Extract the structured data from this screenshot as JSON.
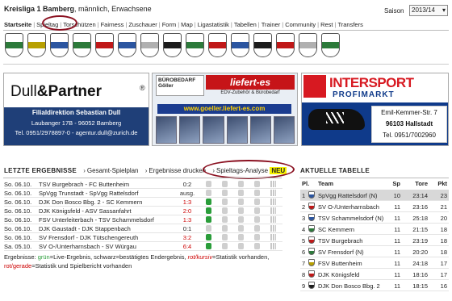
{
  "header": {
    "title_bold": "Kreisliga 1 Bamberg",
    "title_rest": ", männlich, Erwachsene",
    "saison_label": "Saison",
    "saison_value": "2013/14"
  },
  "nav": [
    "Startseite",
    "Spieltag",
    "Torschützen",
    "Fairness",
    "Zuschauer",
    "Form",
    "Map",
    "Ligastatistik",
    "Tabellen",
    "Trainer",
    "Community",
    "Rest",
    "Transfers"
  ],
  "crest_colors": [
    "#2c7a3a",
    "#b8a000",
    "#2b55a0",
    "#2c7a3a",
    "#c01818",
    "#2b55a0",
    "#b0b0b0",
    "#1c1c1c",
    "#2c7a3a",
    "#c01818",
    "#2b55a0",
    "#1c1c1c",
    "#c01818",
    "#b0b0b0",
    "#2c7a3a"
  ],
  "banner_dull": {
    "title_a": "Dull",
    "title_b": "&Partner",
    "reg": "®",
    "line1": "Filialdirektion Sebastian Dull",
    "line2": "Laubanger 17B - 96052 Bamberg",
    "line3": "Tel. 0951/2978897-0 - agentur.dull@zurich.de"
  },
  "banner_goeller": {
    "box": "BÜROBEDARF Göller",
    "brand": "liefert-es",
    "sub": "EDV-Zubehör & Bürobedarf",
    "url": "www.goeller.liefert-es.com"
  },
  "banner_intersport": {
    "name": "INTERSPORT",
    "sub": "PROFIMARKT",
    "addr1": "Emil-Kemmer-Str. 7",
    "addr2": "96103 Hallstadt",
    "addr3": "Tel. 0951/7002960"
  },
  "results_section": {
    "heading": "LETZTE ERGEBNISSE",
    "link1": "Gesamt-Spielplan",
    "link2": "Ergebnisse drucken",
    "link3": "Spieltags-Analyse",
    "badge": "NEU"
  },
  "results": [
    {
      "date": "So. 06.10.",
      "match": "TSV Burgebrach - FC Buttenheim",
      "score": "0:2",
      "kind": "normal",
      "pin": false
    },
    {
      "date": "So. 06.10.",
      "match": "SpVgg Trunstadt - SpVgg Rattelsdorf",
      "score": "ausg.",
      "kind": "ausg",
      "pin": false
    },
    {
      "date": "So. 06.10.",
      "match": "DJK Don Bosco Bbg. 2 - SC Kemmern",
      "score": "1:3",
      "kind": "live",
      "pin": true
    },
    {
      "date": "So. 06.10.",
      "match": "DJK Königsfeld - ASV Sassanfahrt",
      "score": "2:0",
      "kind": "live",
      "pin": true
    },
    {
      "date": "So. 06.10.",
      "match": "FSV Unterleiterbach - TSV Schammelsdorf",
      "score": "1:3",
      "kind": "live",
      "pin": true
    },
    {
      "date": "So. 06.10.",
      "match": "DJK Gaustadt - DJK Stappenbach",
      "score": "0:1",
      "kind": "normal",
      "pin": false
    },
    {
      "date": "So. 06.10.",
      "match": "SV Frensdorf - DJK Tütschengereuth",
      "score": "3:2",
      "kind": "live",
      "pin": true
    },
    {
      "date": "Sa. 05.10.",
      "match": "SV O-/Unterharnsbach - SV Würgau",
      "score": "6:4",
      "kind": "live",
      "pin": true
    }
  ],
  "legend": {
    "prefix": "Ergebnisse: ",
    "green": "grün",
    "part1": "=Live-Ergebnis, schwarz=bestätigtes Endergebnis, ",
    "redital": "rot/kursiv",
    "part2": "=Statistik vorhanden, ",
    "redstraight": "rot/gerade",
    "part3": "=Statistik und Spielbericht vorhanden"
  },
  "table_section": {
    "heading": "AKTUELLE TABELLE",
    "cols": {
      "pl": "Pl.",
      "team": "Team",
      "sp": "Sp",
      "tore": "Tore",
      "pkt": "Pkt"
    }
  },
  "table": [
    {
      "pl": "1",
      "team": "SpVgg Rattelsdorf (N)",
      "sp": "10",
      "tore": "23:14",
      "pkt": "23",
      "color": "#2b55a0",
      "hl": true
    },
    {
      "pl": "2",
      "team": "SV O-/Unterharnsbach",
      "sp": "11",
      "tore": "23:16",
      "pkt": "21",
      "color": "#c01818",
      "hl": false
    },
    {
      "pl": "3",
      "team": "TSV Schammelsdorf (N)",
      "sp": "11",
      "tore": "25:18",
      "pkt": "20",
      "color": "#2b55a0",
      "hl": false
    },
    {
      "pl": "4",
      "team": "SC Kemmern",
      "sp": "11",
      "tore": "21:15",
      "pkt": "18",
      "color": "#2c7a3a",
      "hl": false
    },
    {
      "pl": "5",
      "team": "TSV Burgebrach",
      "sp": "11",
      "tore": "23:19",
      "pkt": "18",
      "color": "#c01818",
      "hl": false
    },
    {
      "pl": "6",
      "team": "SV Frensdorf (N)",
      "sp": "11",
      "tore": "20:20",
      "pkt": "18",
      "color": "#2c7a3a",
      "hl": false
    },
    {
      "pl": "7",
      "team": "FSV Buttenheim",
      "sp": "11",
      "tore": "24:18",
      "pkt": "17",
      "color": "#b8a000",
      "hl": false
    },
    {
      "pl": "8",
      "team": "DJK Königsfeld",
      "sp": "11",
      "tore": "18:16",
      "pkt": "17",
      "color": "#c01818",
      "hl": false
    },
    {
      "pl": "9",
      "team": "DJK Don Bosco Bbg. 2",
      "sp": "11",
      "tore": "18:15",
      "pkt": "16",
      "color": "#1c1c1c",
      "hl": false
    }
  ]
}
